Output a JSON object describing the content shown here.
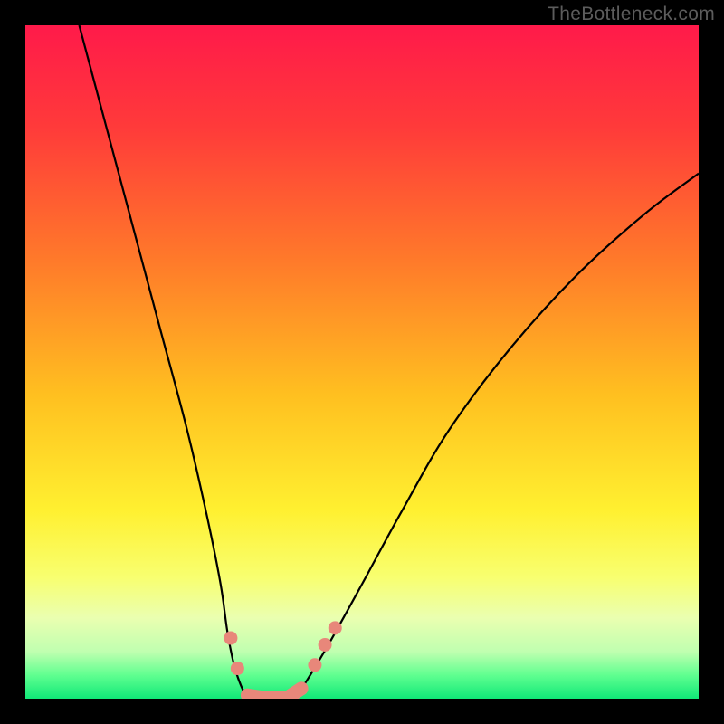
{
  "watermark": "TheBottleneck.com",
  "chart_data": {
    "type": "line",
    "title": "",
    "xlabel": "",
    "ylabel": "",
    "xlim": [
      0,
      100
    ],
    "ylim": [
      0,
      100
    ],
    "left_curve": {
      "description": "Steep descending curve from top-left to valley",
      "points": [
        {
          "x": 8,
          "y": 100
        },
        {
          "x": 12,
          "y": 85
        },
        {
          "x": 16,
          "y": 70
        },
        {
          "x": 20,
          "y": 55
        },
        {
          "x": 24,
          "y": 40
        },
        {
          "x": 27,
          "y": 27
        },
        {
          "x": 29,
          "y": 17
        },
        {
          "x": 30,
          "y": 10
        },
        {
          "x": 31,
          "y": 5
        },
        {
          "x": 32,
          "y": 2
        },
        {
          "x": 33,
          "y": 0
        }
      ]
    },
    "valley": {
      "description": "Flat bottom of V",
      "points": [
        {
          "x": 33,
          "y": 0
        },
        {
          "x": 40,
          "y": 0
        }
      ]
    },
    "right_curve": {
      "description": "Ascending curve from valley to upper-right",
      "points": [
        {
          "x": 40,
          "y": 0
        },
        {
          "x": 42,
          "y": 3
        },
        {
          "x": 45,
          "y": 8
        },
        {
          "x": 50,
          "y": 17
        },
        {
          "x": 56,
          "y": 28
        },
        {
          "x": 63,
          "y": 40
        },
        {
          "x": 72,
          "y": 52
        },
        {
          "x": 82,
          "y": 63
        },
        {
          "x": 92,
          "y": 72
        },
        {
          "x": 100,
          "y": 78
        }
      ]
    },
    "markers": {
      "description": "Salmon-colored rounded markers near valley",
      "color": "#e8877a",
      "points": [
        {
          "x": 30.5,
          "y": 9
        },
        {
          "x": 31.5,
          "y": 4.5
        },
        {
          "x": 33,
          "y": 0.5
        },
        {
          "x": 35,
          "y": 0.2
        },
        {
          "x": 37,
          "y": 0.2
        },
        {
          "x": 39,
          "y": 0.2
        },
        {
          "x": 41,
          "y": 1.5
        },
        {
          "x": 43,
          "y": 5
        },
        {
          "x": 44.5,
          "y": 8
        },
        {
          "x": 46,
          "y": 10.5
        }
      ]
    },
    "gradient_stops": [
      {
        "offset": 0,
        "color": "#ff1a4a"
      },
      {
        "offset": 0.15,
        "color": "#ff3a3a"
      },
      {
        "offset": 0.35,
        "color": "#ff7a2a"
      },
      {
        "offset": 0.55,
        "color": "#ffc020"
      },
      {
        "offset": 0.72,
        "color": "#fff030"
      },
      {
        "offset": 0.82,
        "color": "#f8ff70"
      },
      {
        "offset": 0.88,
        "color": "#eaffb0"
      },
      {
        "offset": 0.93,
        "color": "#c0ffb0"
      },
      {
        "offset": 0.965,
        "color": "#60ff90"
      },
      {
        "offset": 1.0,
        "color": "#10e878"
      }
    ]
  }
}
